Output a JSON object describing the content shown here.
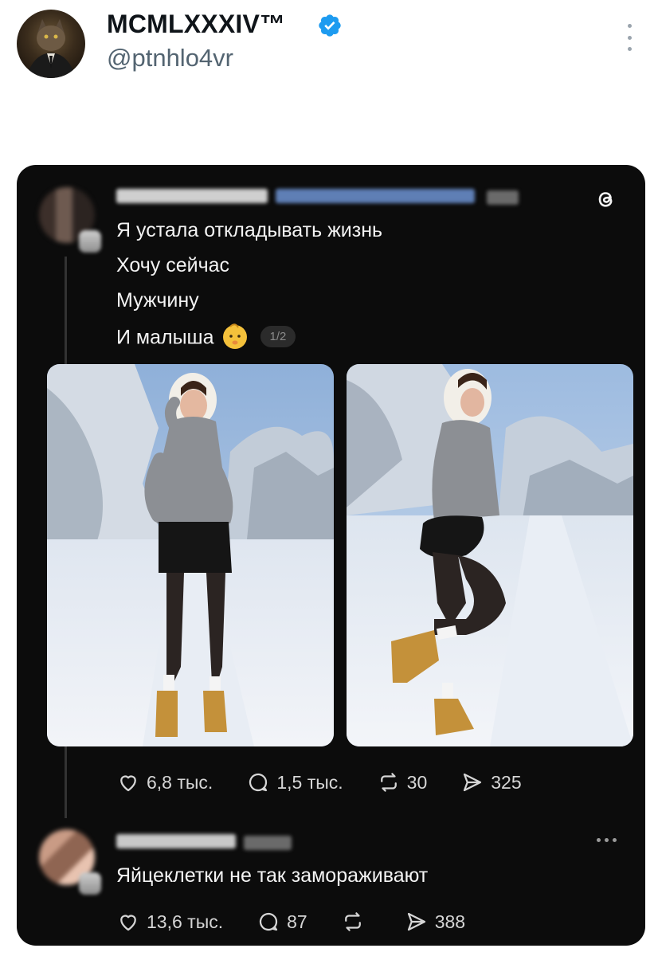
{
  "author": {
    "display_name": "MCMLXXXIV™",
    "handle": "@ptnhlo4vr",
    "verified": true,
    "avatar_icon": "cat-in-suit-avatar"
  },
  "embedded_post": {
    "app_icon": "threads-logo-icon",
    "lines": [
      "Я устала откладывать жизнь",
      "Хочу сейчас",
      "Мужчину",
      "И малыша"
    ],
    "emoji": "baby-emoji-icon",
    "page_indicator": "1/2",
    "photos": [
      "photo-front-view",
      "photo-side-view"
    ],
    "stats": {
      "likes": "6,8 тыс.",
      "replies": "1,5 тыс.",
      "reposts": "30",
      "shares": "325"
    }
  },
  "reply": {
    "text": "Яйцеклетки не так замораживают",
    "stats": {
      "likes": "13,6 тыс.",
      "replies": "87",
      "reposts": "",
      "shares": "388"
    }
  },
  "colors": {
    "card_bg": "#0c0c0c",
    "verified_blue": "#1d9bf0",
    "handle_gray": "#536471"
  }
}
